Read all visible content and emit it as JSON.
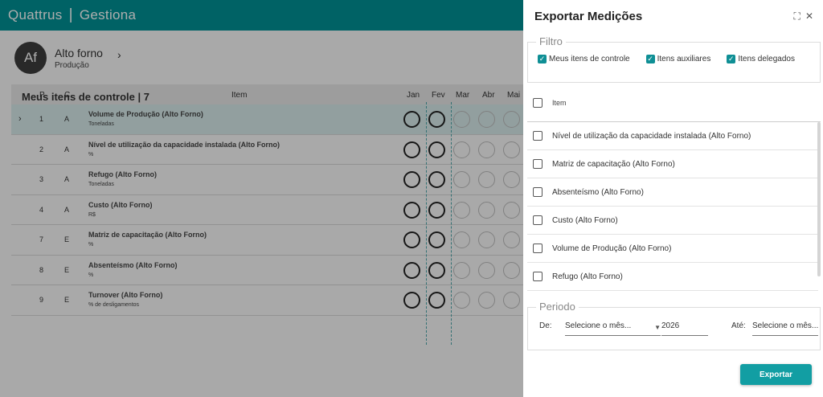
{
  "app": {
    "brand_name": "Quattrus",
    "brand_sep": "|",
    "brand_module": "Gestiona",
    "colors": {
      "primary": "#009196",
      "accent": "#0f8f95"
    }
  },
  "profile": {
    "initials": "Af",
    "name": "Alto forno",
    "area": "Produção"
  },
  "section": {
    "title": "Meus itens de controle | 7"
  },
  "grid": {
    "headers": {
      "p": "P",
      "c": "C",
      "item": "Item"
    },
    "months": [
      "Jan",
      "Fev",
      "Mar",
      "Abr",
      "Mai"
    ],
    "rows": [
      {
        "p": "1",
        "c": "A",
        "name": "Volume de Produção (Alto Forno)",
        "unit": "Toneladas",
        "selected": true,
        "filled": 2
      },
      {
        "p": "2",
        "c": "A",
        "name": "Nível de utilização da capacidade instalada (Alto Forno)",
        "unit": "%",
        "filled": 2
      },
      {
        "p": "3",
        "c": "A",
        "name": "Refugo (Alto Forno)",
        "unit": "Toneladas",
        "filled": 2
      },
      {
        "p": "4",
        "c": "A",
        "name": "Custo (Alto Forno)",
        "unit": "R$",
        "filled": 2
      },
      {
        "p": "7",
        "c": "E",
        "name": "Matriz de capacitação (Alto Forno)",
        "unit": "%",
        "filled": 2
      },
      {
        "p": "8",
        "c": "E",
        "name": "Absenteísmo (Alto Forno)",
        "unit": "%",
        "filled": 2
      },
      {
        "p": "9",
        "c": "E",
        "name": "Turnover (Alto Forno)",
        "unit": "% de desligamentos",
        "filled": 2
      }
    ]
  },
  "panel": {
    "title": "Exportar Medições",
    "filter": {
      "legend": "Filtro",
      "options": [
        {
          "label": "Meus itens de controle",
          "checked": true
        },
        {
          "label": "Itens auxiliares",
          "checked": true
        },
        {
          "label": "Itens delegados",
          "checked": true
        }
      ]
    },
    "list": {
      "header": "Item",
      "items": [
        "Nível de utilização da capacidade instalada (Alto Forno)",
        "Matriz de capacitação (Alto Forno)",
        "Absenteísmo (Alto Forno)",
        "Custo (Alto Forno)",
        "Volume de Produção (Alto Forno)",
        "Refugo (Alto Forno)"
      ]
    },
    "period": {
      "legend": "Periodo",
      "from_label": "De:",
      "from_month_placeholder": "Selecione o mês...",
      "from_year": "2026",
      "to_label": "Até:",
      "to_month_placeholder": "Selecione o mês..."
    },
    "export_label": "Exportar"
  }
}
